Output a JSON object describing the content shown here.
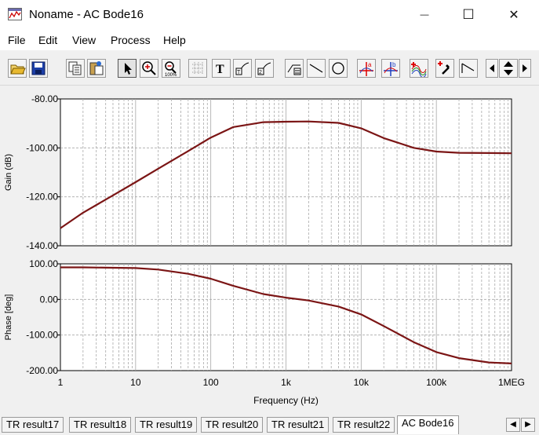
{
  "window": {
    "title": "Noname - AC Bode16",
    "minimize": "—",
    "maximize": "☐",
    "close": "✕"
  },
  "menu": [
    "File",
    "Edit",
    "View",
    "Process",
    "Help"
  ],
  "toolbar_icons": [
    "open-folder-icon",
    "save-disk-icon",
    "copy-icon",
    "paste-icon",
    "pointer-icon",
    "zoom-in-icon",
    "zoom-100-icon",
    "grid-icon",
    "text-icon",
    "curve-label-icon",
    "curve-label-2-icon",
    "curve-label-3-icon",
    "line-icon",
    "circle-icon",
    "cursor-a-icon",
    "cursor-b-icon",
    "add-curve-icon",
    "add-cursor-icon",
    "step-icon",
    "scroll-left-icon",
    "scroll-up-down-icon",
    "scroll-right-icon"
  ],
  "tabs": [
    "TR result17",
    "TR result18",
    "TR result19",
    "TR result20",
    "TR result21",
    "TR result22",
    "AC Bode16"
  ],
  "active_tab": "AC Bode16",
  "colors": {
    "curve": "#7b1515",
    "grid": "#a8a8a8",
    "plot_bg": "#ffffff"
  },
  "chart_data": [
    {
      "type": "line",
      "ylabel": "Gain (dB)",
      "ylim": [
        -140,
        -80
      ],
      "yticks": [
        "-80.00",
        "-100.00",
        "-120.00",
        "-140.00"
      ],
      "xscale": "log",
      "xlim": [
        1,
        1000000
      ],
      "grid": true,
      "x": [
        1,
        2,
        5,
        10,
        20,
        50,
        100,
        200,
        500,
        1000,
        2000,
        5000,
        10000,
        20000,
        50000,
        100000,
        200000,
        500000,
        1000000
      ],
      "values": [
        -132.8,
        -126.5,
        -119.4,
        -114.0,
        -108.5,
        -101.3,
        -95.8,
        -91.5,
        -89.5,
        -89.3,
        -89.2,
        -89.8,
        -92.0,
        -96.0,
        -100.0,
        -101.5,
        -102.0,
        -102.1,
        -102.2
      ]
    },
    {
      "type": "line",
      "ylabel": "Phase [deg]",
      "xlabel": "Frequency (Hz)",
      "ylim": [
        -200,
        100
      ],
      "yticks": [
        "100.00",
        "0.00",
        "-100.00",
        "-200.00"
      ],
      "xscale": "log",
      "xlim": [
        1,
        1000000
      ],
      "xticks": [
        "1",
        "10",
        "100",
        "1k",
        "10k",
        "100k",
        "1MEG"
      ],
      "grid": true,
      "x": [
        1,
        2,
        5,
        10,
        20,
        50,
        100,
        200,
        500,
        1000,
        2000,
        5000,
        10000,
        20000,
        50000,
        100000,
        200000,
        500000,
        1000000
      ],
      "values": [
        90,
        90,
        89,
        88,
        84,
        72,
        58,
        38,
        15,
        5,
        -3,
        -20,
        -42,
        -75,
        -120,
        -148,
        -165,
        -177,
        -180
      ]
    }
  ]
}
